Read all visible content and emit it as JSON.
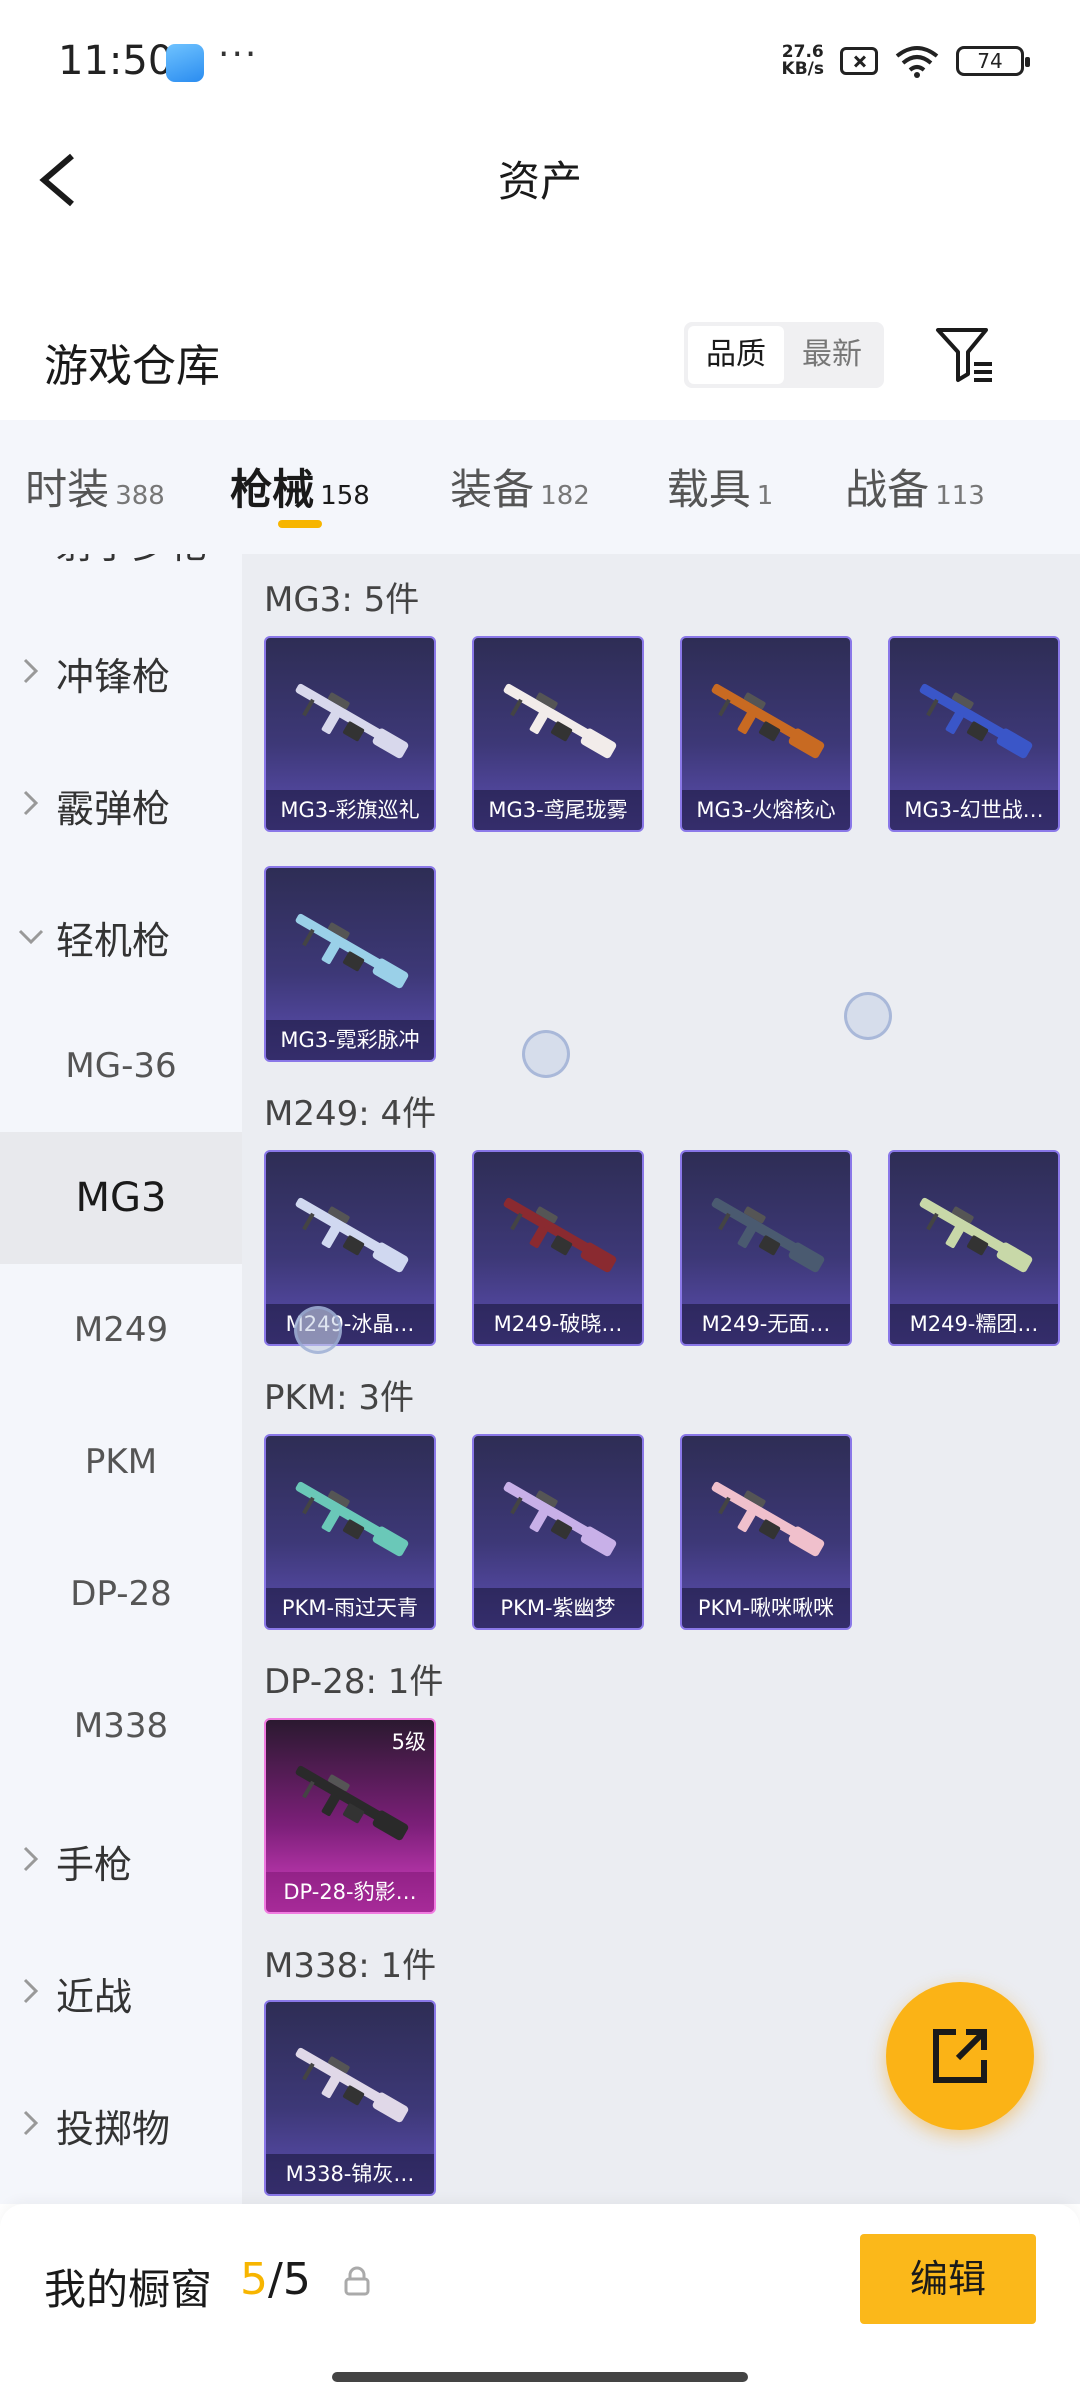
{
  "status_bar": {
    "time": "11:50",
    "more": "···",
    "net_speed_value": "27.6",
    "net_speed_unit": "KB/s",
    "battery": "74"
  },
  "header": {
    "title": "资产"
  },
  "warehouse": {
    "title": "游戏仓库",
    "sort_options": [
      "品质",
      "最新"
    ],
    "active_sort": "品质"
  },
  "tabs": [
    {
      "label": "时装",
      "count": "388"
    },
    {
      "label": "枪械",
      "count": "158",
      "active": true
    },
    {
      "label": "装备",
      "count": "182"
    },
    {
      "label": "载具",
      "count": "1"
    },
    {
      "label": "战备",
      "count": "113"
    }
  ],
  "sidenav": {
    "partial_top": "射手步枪",
    "categories": [
      "冲锋枪",
      "霰弹枪",
      "轻机枪"
    ],
    "subitems": [
      "MG-36",
      "MG3",
      "M249",
      "PKM",
      "DP-28",
      "M338"
    ],
    "active_sub": "MG3",
    "more_categories": [
      "手枪",
      "近战",
      "投掷物"
    ]
  },
  "groups": [
    {
      "title": "MG3: 5件",
      "items": [
        "MG3-彩旗巡礼",
        "MG3-鸢尾珑雾",
        "MG3-火熔核心",
        "MG3-幻世战…",
        "MG3-霓彩脉冲"
      ]
    },
    {
      "title": "M249: 4件",
      "items": [
        "M249-冰晶…",
        "M249-破晓…",
        "M249-无面…",
        "M249-糯团…"
      ]
    },
    {
      "title": "PKM: 3件",
      "items": [
        "PKM-雨过天青",
        "PKM-紫幽梦",
        "PKM-啾咪啾咪"
      ]
    },
    {
      "title": "DP-28: 1件",
      "items": [
        "DP-28-豹影…"
      ],
      "level_badge": "5级"
    },
    {
      "title": "M338: 1件",
      "items": [
        "M338-锦灰…"
      ]
    }
  ],
  "gun_colors": [
    "#d8d8ec",
    "#f2ecea",
    "#c86a22",
    "#3a56c8",
    "#9ad0e8",
    "#d0d8f0",
    "#8a2a30",
    "#4a5a70",
    "#c8d8a8",
    "#6ac8b8",
    "#c8b0e8",
    "#f0c0cc",
    "#2a2a2a",
    "#e0d8e8"
  ],
  "bottom_bar": {
    "label": "我的橱窗",
    "count": "5",
    "separator": "/",
    "total": "5",
    "edit_label": "编辑"
  },
  "colors": {
    "accent": "#f7b500",
    "card_rare": "#5d4fb3",
    "card_legend": "#d741c4"
  }
}
